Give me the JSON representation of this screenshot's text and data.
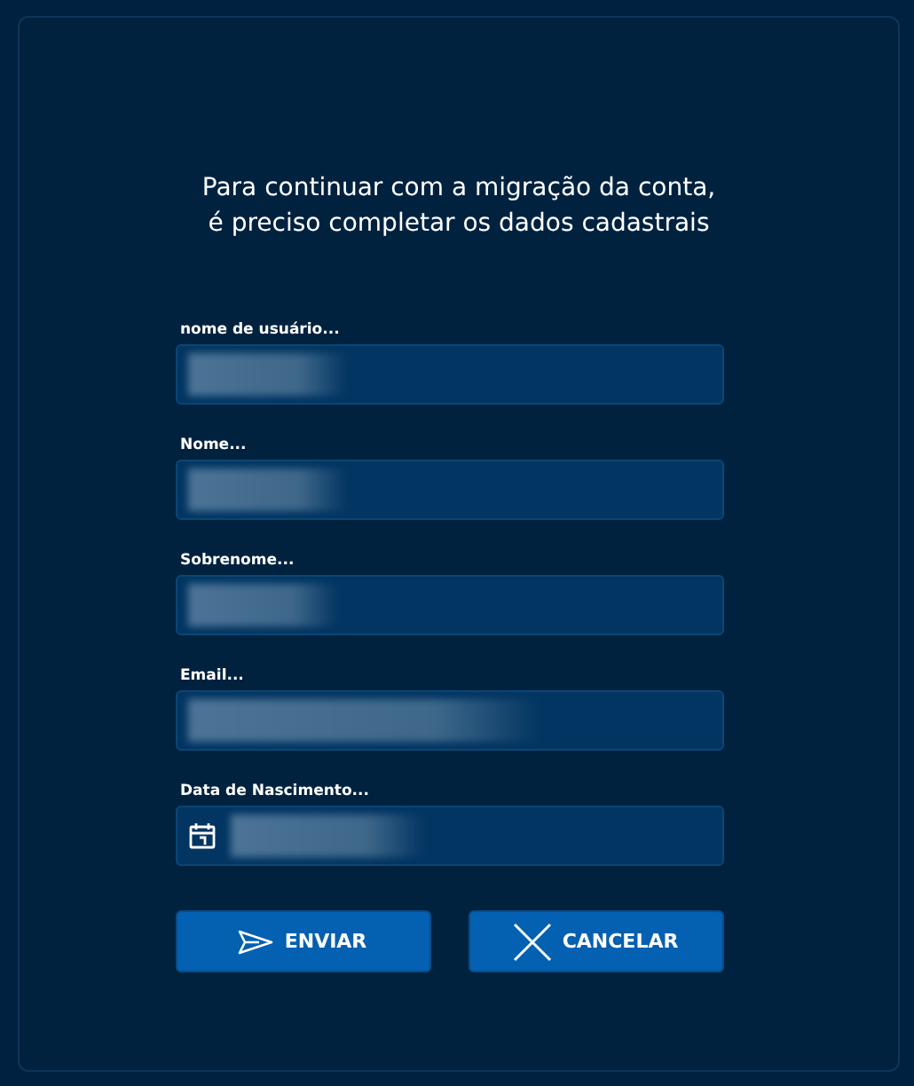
{
  "heading": {
    "line_1": "Para continuar com a migração da conta,",
    "line_2": "é preciso completar os dados cadastrais"
  },
  "fields": [
    {
      "kind": "text",
      "label": "nome de usuário...",
      "redacted": true
    },
    {
      "kind": "text",
      "label": "Nome...",
      "redacted": true
    },
    {
      "kind": "text",
      "label": "Sobrenome...",
      "redacted": true
    },
    {
      "kind": "text",
      "label": "Email...",
      "redacted": true
    },
    {
      "kind": "date",
      "label": "Data de Nascimento...",
      "redacted": true
    }
  ],
  "buttons": [
    {
      "kind": "send",
      "label": "ENVIAR"
    },
    {
      "kind": "cancel",
      "label": "CANCELAR"
    }
  ]
}
